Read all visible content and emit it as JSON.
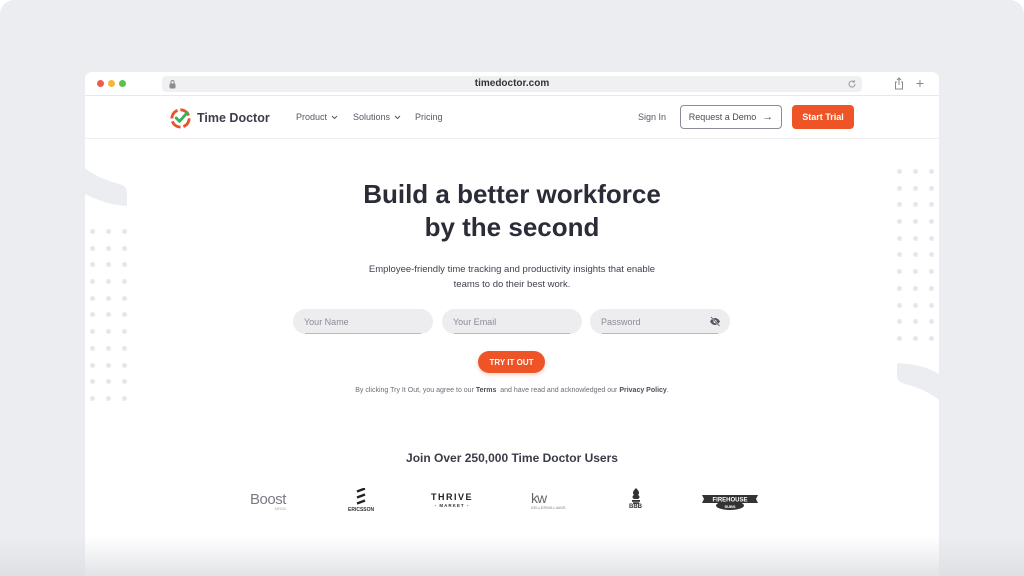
{
  "browser": {
    "url": "timedoctor.com",
    "icons": {
      "close": "traffic-light-red",
      "minimize": "traffic-light-yellow",
      "maximize": "traffic-light-green",
      "lock": "lock-icon",
      "reload": "reload-icon",
      "share": "share-icon",
      "new_tab": "plus-icon"
    },
    "new_tab_glyph": "+"
  },
  "nav": {
    "brand": "Time Doctor",
    "links": [
      {
        "label": "Product",
        "has_dropdown": true
      },
      {
        "label": "Solutions",
        "has_dropdown": true
      },
      {
        "label": "Pricing",
        "has_dropdown": false
      }
    ],
    "sign_in": "Sign In",
    "request_demo": "Request a Demo",
    "request_demo_arrow": "→",
    "start_trial": "Start Trial"
  },
  "hero": {
    "title_line1": "Build a better workforce",
    "title_line2": "by the second",
    "subtitle_line1": "Employee-friendly time tracking and productivity insights that enable",
    "subtitle_line2": "teams to do their best work.",
    "form": {
      "name_placeholder": "Your Name",
      "email_placeholder": "Your Email",
      "password_placeholder": "Password",
      "name_value": "",
      "email_value": "",
      "password_value": ""
    },
    "cta": "TRY IT OUT",
    "legal": {
      "prefix": "By clicking Try It Out, you agree to our ",
      "terms": "Terms",
      "middle": "  and have read and acknowledged our ",
      "privacy": "Privacy Policy",
      "suffix": "."
    }
  },
  "social_proof": {
    "heading": "Join Over 250,000 Time Doctor Users",
    "clients": [
      {
        "name": "Boost",
        "sub": "MEDIA"
      },
      {
        "name": "ERICSSON"
      },
      {
        "name": "THRIVE",
        "sub": "- MARKET -"
      },
      {
        "name": "kw",
        "sub": "KELLERWILLIAMS."
      },
      {
        "name": "BBB"
      },
      {
        "name": "FIREHOUSE",
        "sub": "SUBS"
      }
    ]
  },
  "colors": {
    "accent": "#ef5427",
    "text_dark": "#2a2c38",
    "logo_green": "#35b35a",
    "background": "#ecedf1"
  }
}
